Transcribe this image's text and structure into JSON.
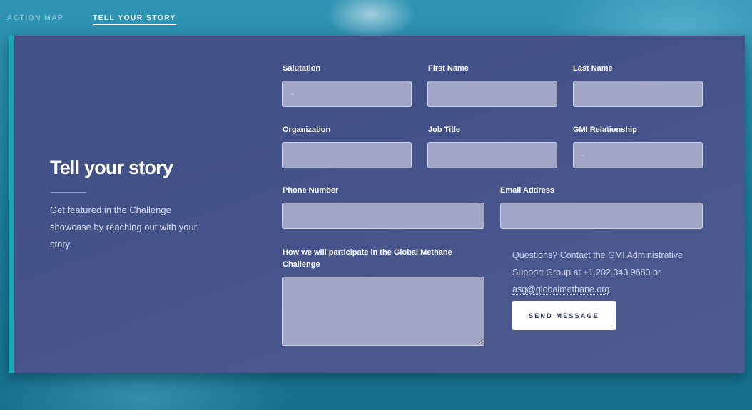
{
  "nav": {
    "items": [
      "ACTION MAP",
      "TELL YOUR STORY"
    ],
    "active_index": 1
  },
  "intro": {
    "heading": "Tell your story",
    "text": "Get featured in the Challenge showcase by reaching out with your story."
  },
  "form": {
    "salutation": {
      "label": "Salutation",
      "value": "-"
    },
    "first_name": {
      "label": "First Name",
      "value": ""
    },
    "last_name": {
      "label": "Last Name",
      "value": ""
    },
    "organization": {
      "label": "Organization",
      "value": ""
    },
    "job_title": {
      "label": "Job Title",
      "value": ""
    },
    "gmi_relationship": {
      "label": "GMI Relationship",
      "value": "-"
    },
    "phone": {
      "label": "Phone Number",
      "value": ""
    },
    "email": {
      "label": "Email Address",
      "value": ""
    },
    "participation": {
      "label": "How we will participate in the Global Methane Challenge",
      "value": ""
    }
  },
  "contact": {
    "text": "Questions? Contact the GMI Administrative Support Group at +1.202.343.9683 or",
    "email": "asg@globalmethane.org"
  },
  "submit_label": "SEND MESSAGE"
}
